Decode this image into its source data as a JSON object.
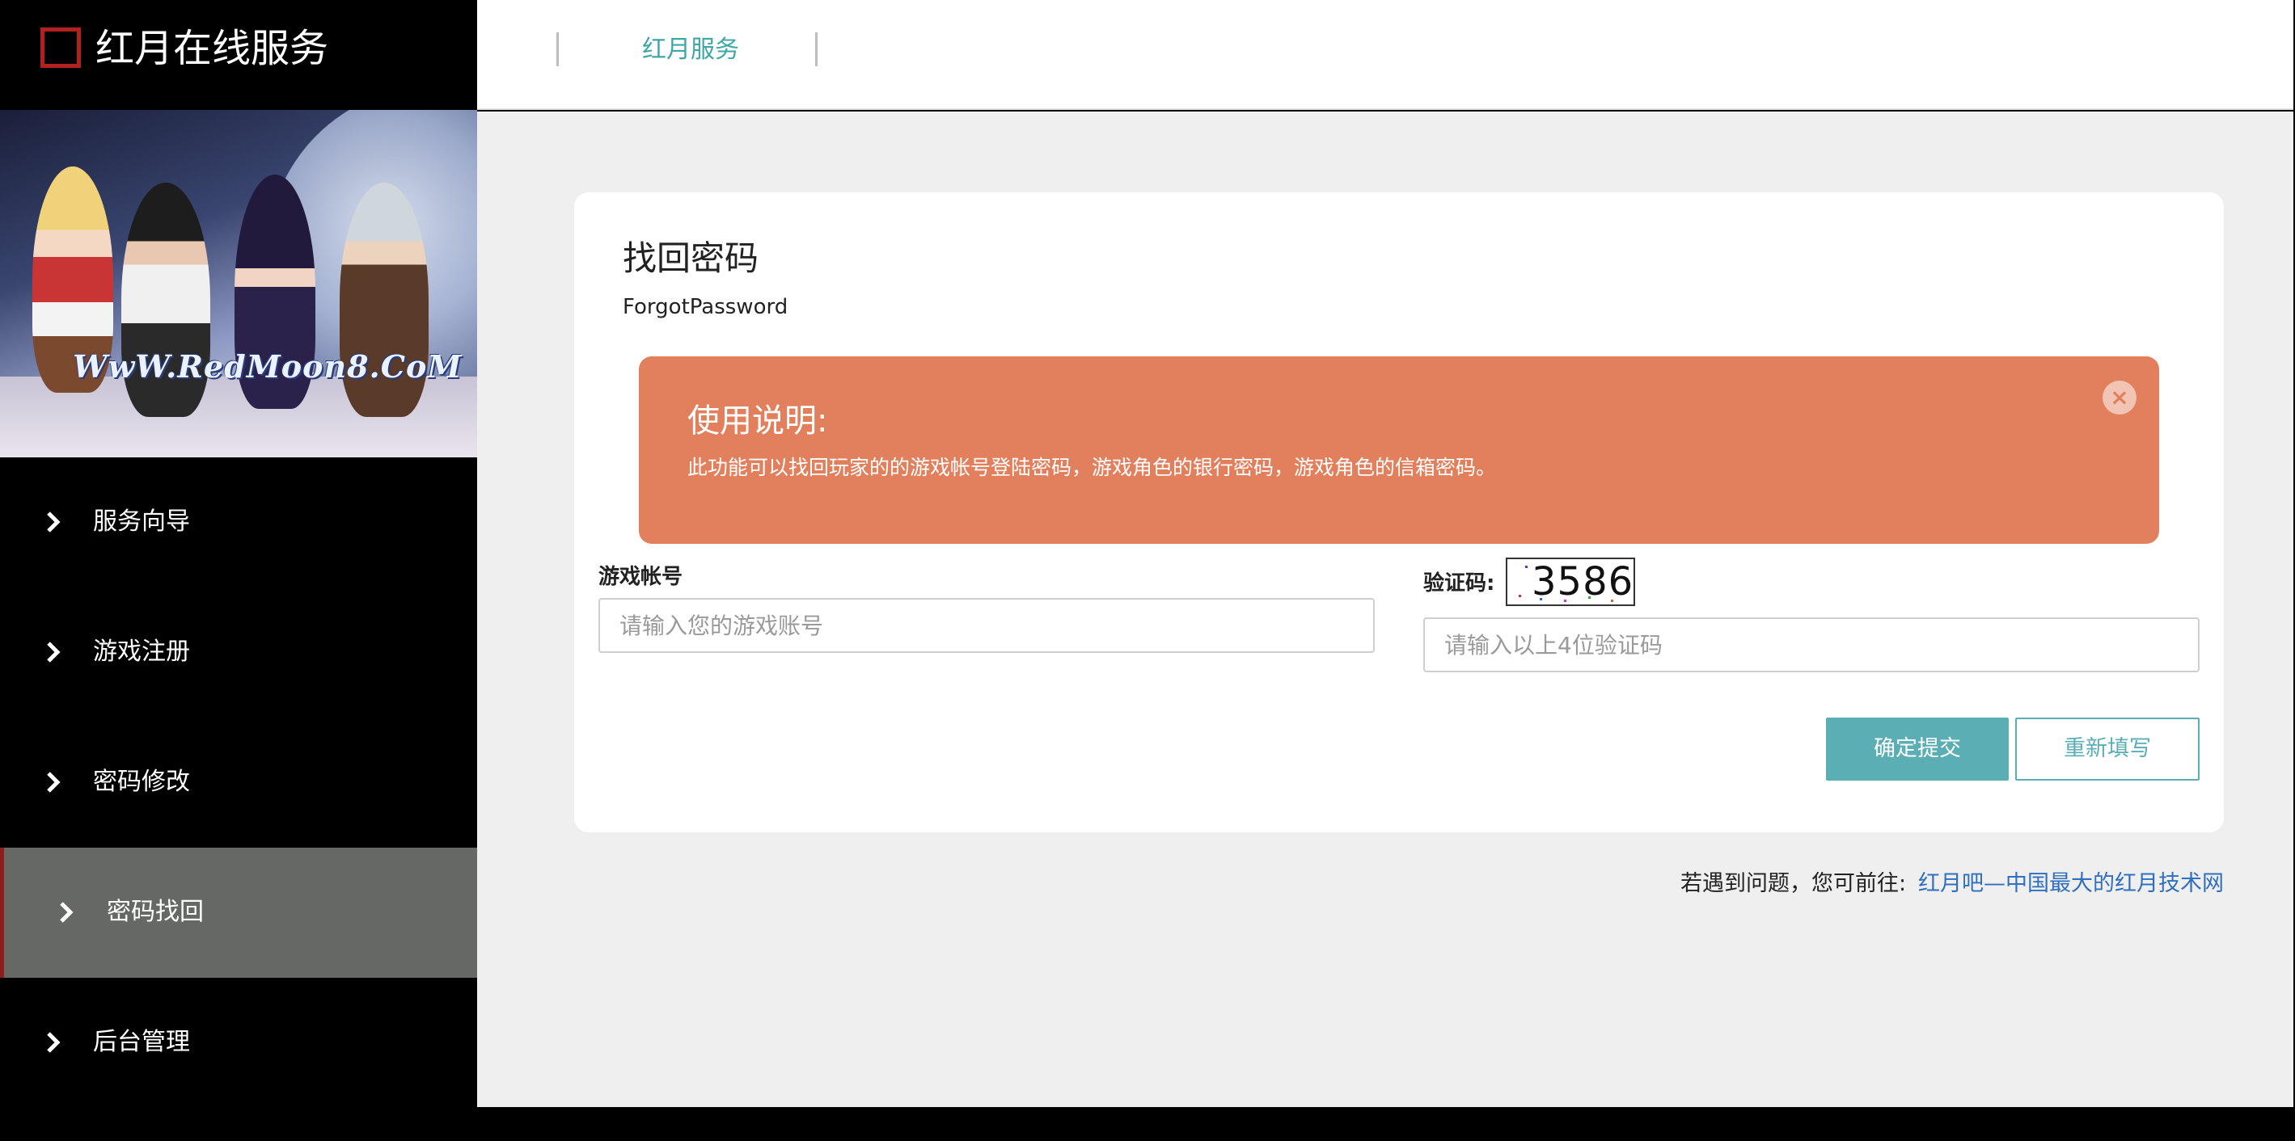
{
  "app": {
    "title": "红月在线服务",
    "banner_watermark": "WwW.RedMoon8.CoM"
  },
  "sidebar": {
    "items": [
      {
        "label": "服务向导",
        "active": false
      },
      {
        "label": "游戏注册",
        "active": false
      },
      {
        "label": "密码修改",
        "active": false
      },
      {
        "label": "密码找回",
        "active": true
      },
      {
        "label": "后台管理",
        "active": false
      }
    ]
  },
  "topbar": {
    "tab_label": "红月服务"
  },
  "page": {
    "title": "找回密码",
    "subtitle": "ForgotPassword"
  },
  "alert": {
    "heading": "使用说明:",
    "text": "此功能可以找回玩家的的游戏帐号登陆密码，游戏角色的银行密码，游戏角色的信箱密码。",
    "close_icon": "×"
  },
  "form": {
    "account_label": "游戏帐号",
    "account_placeholder": "请输入您的游戏账号",
    "account_value": "",
    "captcha_label": "验证码:",
    "captcha_code": "3586",
    "captcha_placeholder": "请输入以上4位验证码",
    "captcha_value": "",
    "submit_label": "确定提交",
    "reset_label": "重新填写"
  },
  "footer": {
    "note": "若遇到问题，您可前往:",
    "link_text": "红月吧—中国最大的红月技术网"
  },
  "colors": {
    "accent": "#5aaeb4",
    "alert_bg": "#e2805e",
    "brand_red": "#b32020",
    "link": "#2f6fbd"
  }
}
